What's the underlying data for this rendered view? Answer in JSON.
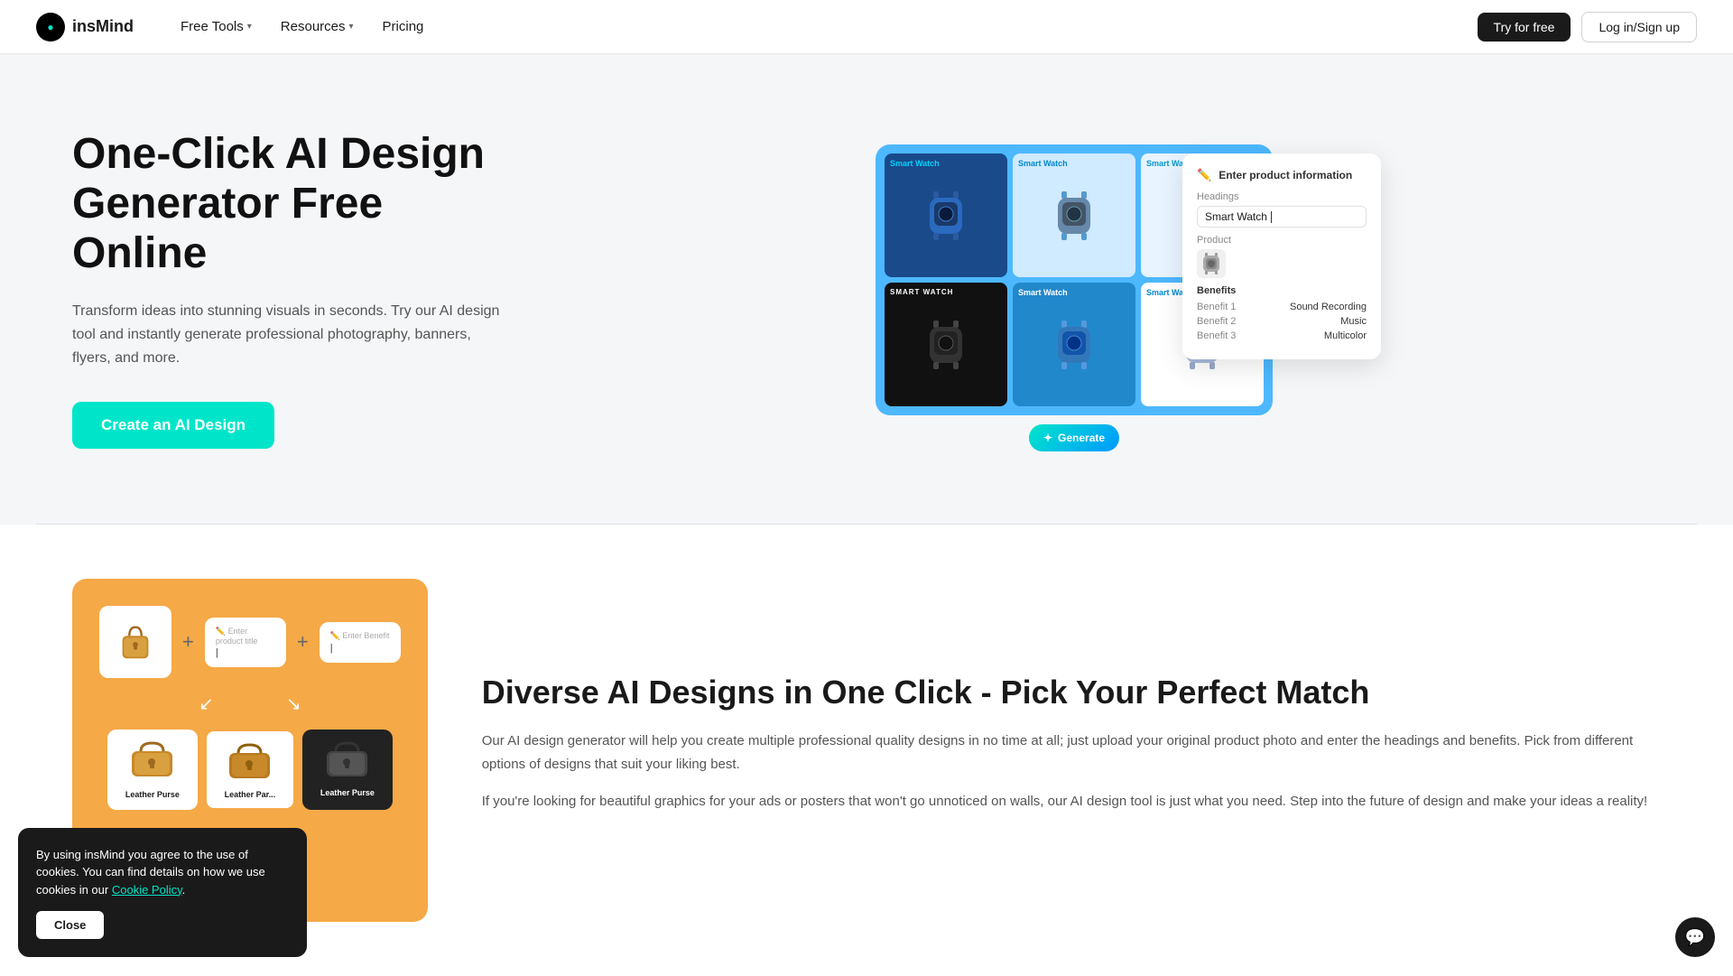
{
  "nav": {
    "logo_text": "insMind",
    "logo_icon": "●",
    "free_tools_label": "Free Tools",
    "resources_label": "Resources",
    "pricing_label": "Pricing",
    "try_free_label": "Try for free",
    "login_label": "Log in/Sign up"
  },
  "hero": {
    "title": "One-Click AI Design Generator Free Online",
    "description": "Transform ideas into stunning visuals in seconds. Try our AI design tool and instantly generate professional photography, banners, flyers, and more.",
    "cta_label": "Create an AI Design",
    "panel": {
      "enter_product_label": "Enter product information",
      "headings_label": "Headings",
      "headings_value": "Smart Watch",
      "product_label": "Product",
      "benefits_label": "Benefits",
      "benefit1_label": "Benefit 1",
      "benefit1_value": "Sound Recording",
      "benefit2_label": "Benefit 2",
      "benefit2_value": "Music",
      "benefit3_label": "Benefit 3",
      "benefit3_value": "Multicolor",
      "generate_label": "Generate"
    },
    "watch_grid": [
      {
        "label": "Smart Watch",
        "bg": "blue-dark",
        "label_color": "white"
      },
      {
        "label": "Smart Watch",
        "bg": "light-blue",
        "label_color": "teal"
      },
      {
        "label": "Smart Watch",
        "bg": "light-blue",
        "label_color": "teal"
      },
      {
        "label": "SMART WATCH",
        "bg": "dark",
        "label_color": "white"
      },
      {
        "label": "Smart Watch",
        "bg": "mid-blue",
        "label_color": "white"
      },
      {
        "label": "Smart Watch",
        "bg": "white",
        "label_color": "blue"
      }
    ]
  },
  "section2": {
    "title": "Diverse AI Designs in One Click - Pick Your Perfect Match",
    "desc1": "Our AI design generator will help you create multiple professional quality designs in no time at all; just upload your original product photo and enter the headings and benefits. Pick from different options of designs that suit your liking best.",
    "desc2": "If you're looking for beautiful graphics for your ads or posters that won't go unnoticed on walls, our AI design tool is just what you need. Step into the future of design and make your ideas a reality!",
    "enter_product_placeholder": "Enter product title|",
    "enter_benefit_placeholder": "Enter Benefit|",
    "variant_labels": [
      "Leather Purse",
      "Leather Par...",
      "Leather Purse"
    ]
  },
  "cookie": {
    "text": "By using insMind you agree to the use of cookies. You can find details on how we use cookies in our",
    "link_text": "Cookie Policy",
    "close_label": "Close"
  },
  "chat": {
    "icon": "💬"
  }
}
